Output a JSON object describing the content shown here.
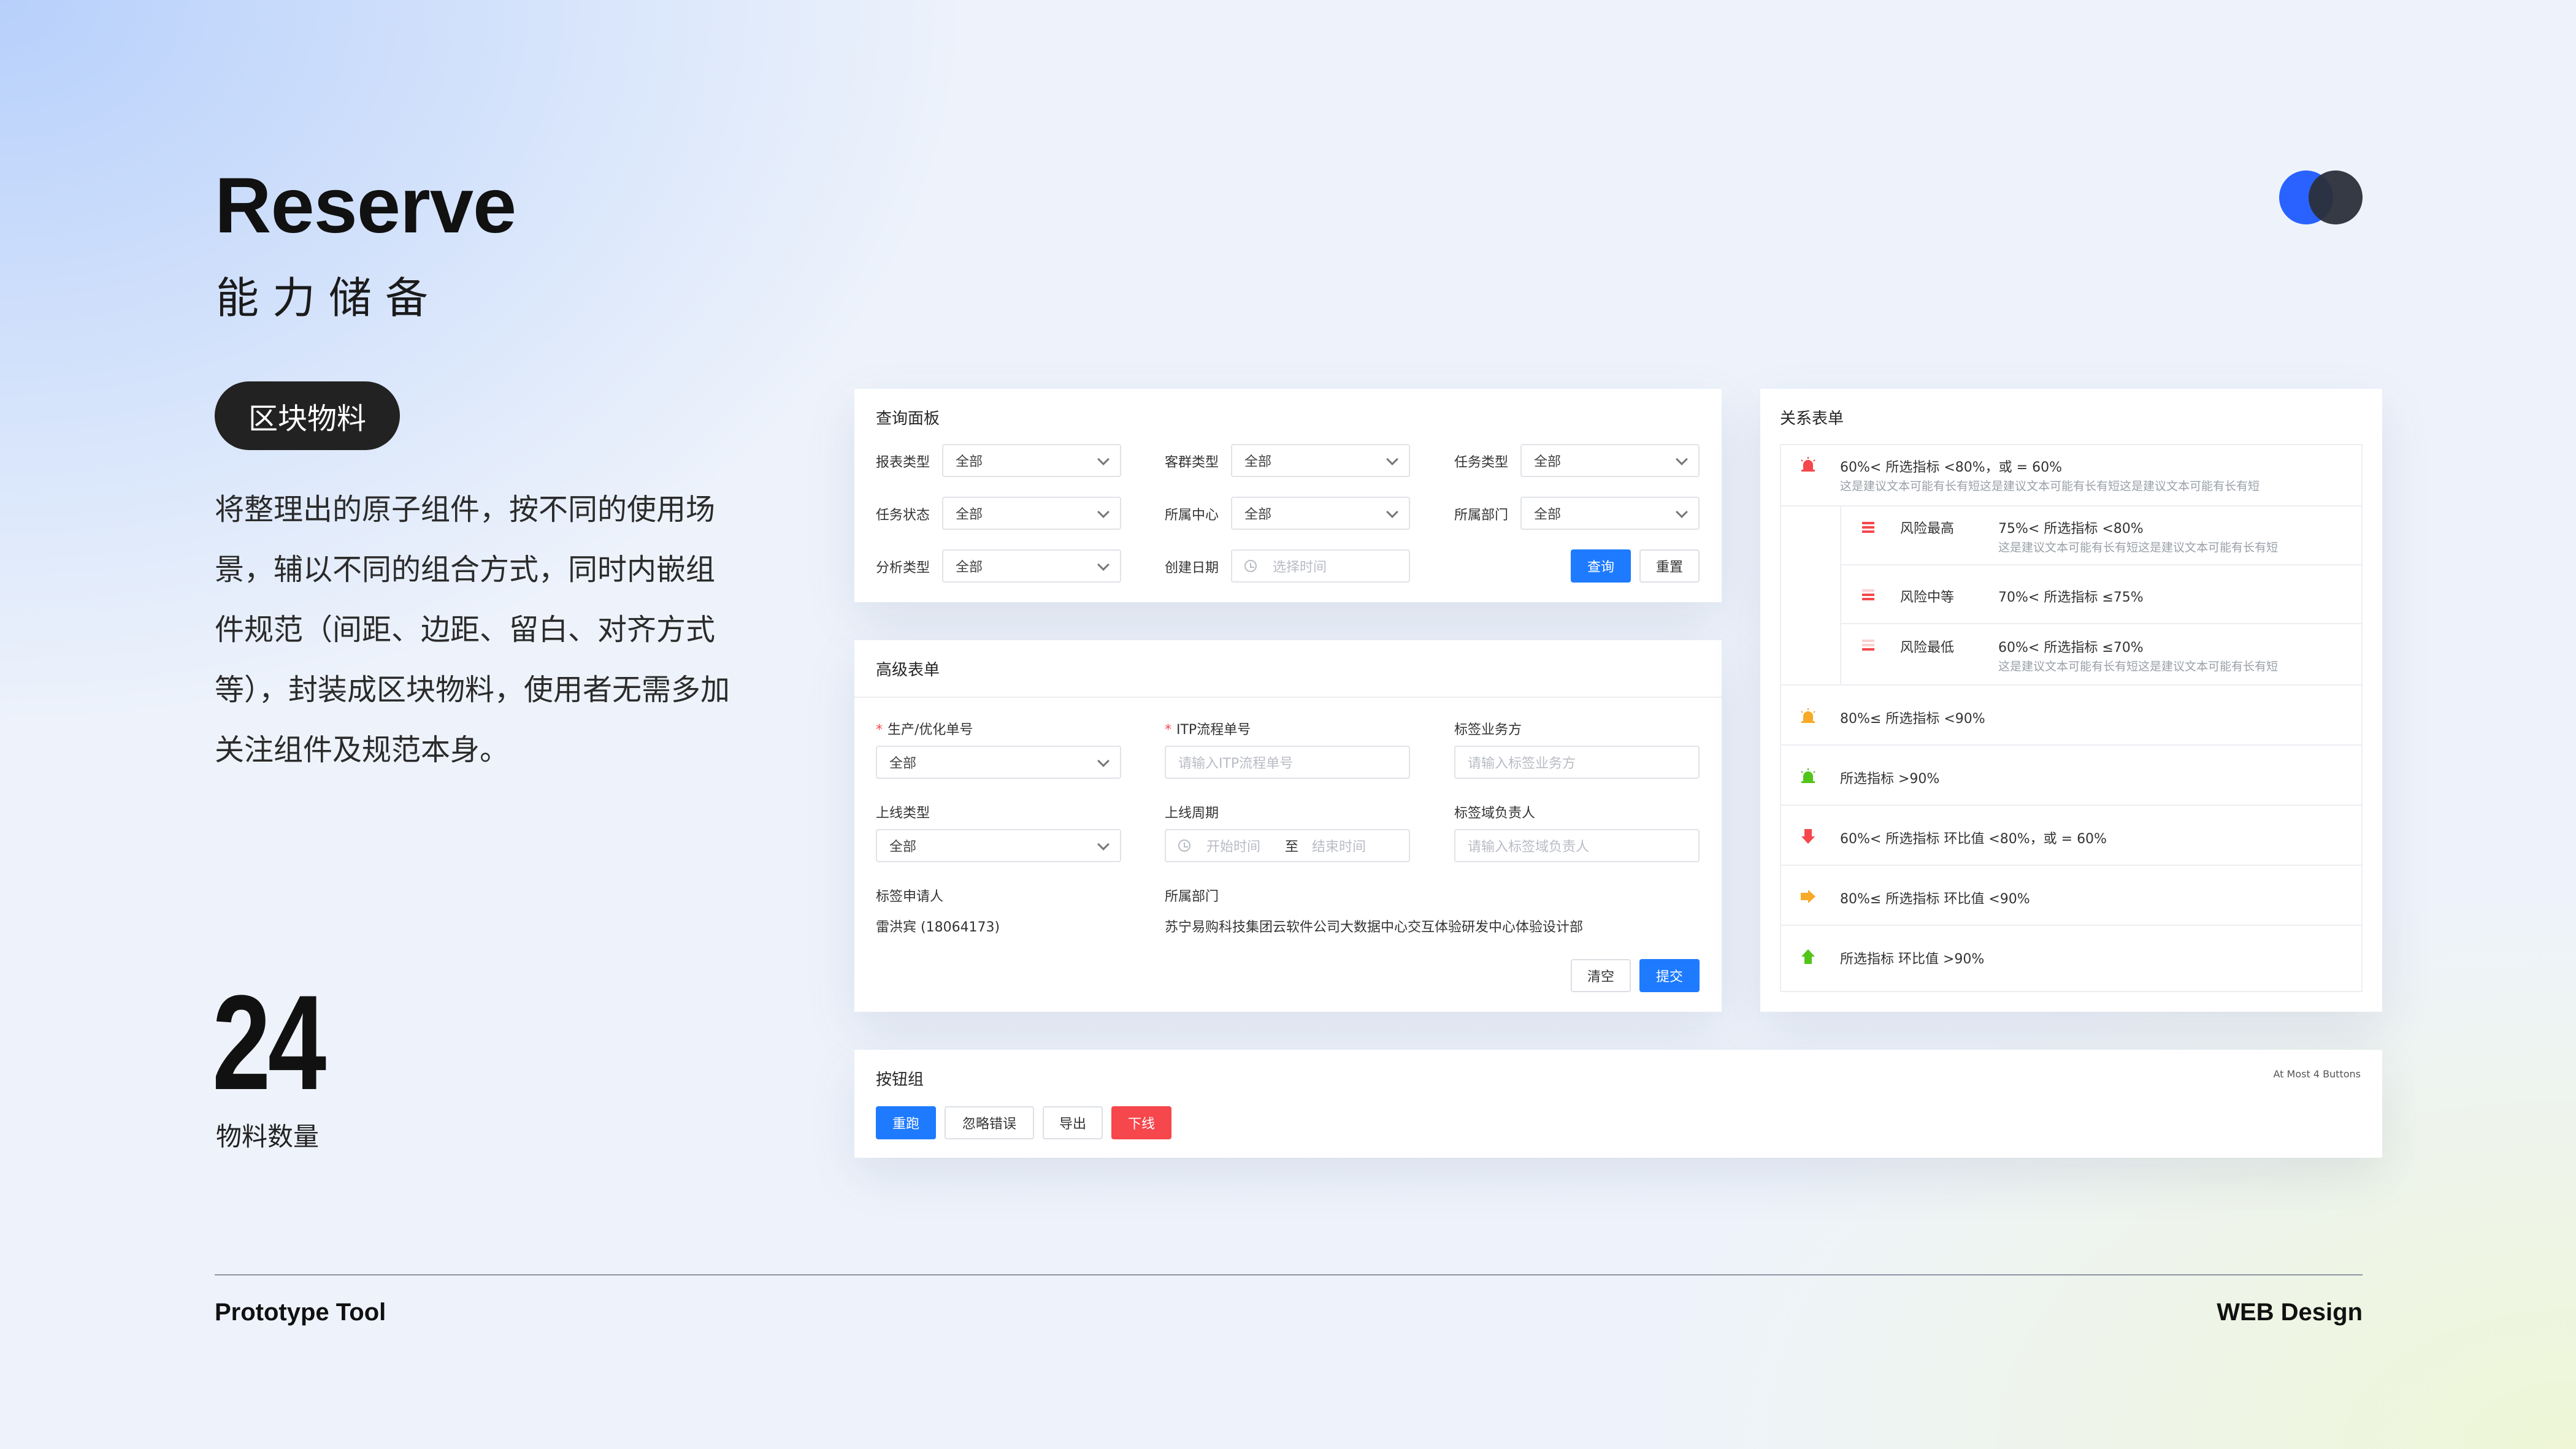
{
  "header": {
    "title": "Reserve",
    "subtitle": "能力储备"
  },
  "pill": "区块物料",
  "description": "将整理出的原子组件，按不同的使用场景，辅以不同的组合方式，同时内嵌组件规范（间距、边距、留白、对齐方式等），封装成区块物料，使用者无需多加关注组件及规范本身。",
  "stats": {
    "count": "24",
    "label": "物料数量"
  },
  "footer": {
    "left": "Prototype Tool",
    "right": "WEB Design"
  },
  "colors": {
    "primary": "#1e7bff",
    "danger": "#f5474c",
    "brand_blue": "#2962ff",
    "dark": "#222222"
  },
  "query_panel": {
    "title": "查询面板",
    "fields": [
      {
        "label": "报表类型",
        "value": "全部"
      },
      {
        "label": "客群类型",
        "value": "全部"
      },
      {
        "label": "任务类型",
        "value": "全部"
      },
      {
        "label": "任务状态",
        "value": "全部"
      },
      {
        "label": "所属中心",
        "value": "全部"
      },
      {
        "label": "所属部门",
        "value": "全部"
      },
      {
        "label": "分析类型",
        "value": "全部"
      },
      {
        "label": "创建日期",
        "placeholder": "选择时间"
      }
    ],
    "search_label": "查询",
    "reset_label": "重置"
  },
  "advanced_form": {
    "title": "高级表单",
    "f1": {
      "label": "生产/优化单号",
      "value": "全部"
    },
    "f2": {
      "label": "ITP流程单号",
      "placeholder": "请输入ITP流程单号"
    },
    "f3": {
      "label": "标签业务方",
      "placeholder": "请输入标签业务方"
    },
    "f4": {
      "label": "上线类型",
      "value": "全部"
    },
    "f5": {
      "label": "上线周期",
      "start": "开始时间",
      "sep": "至",
      "end": "结束时间"
    },
    "f6": {
      "label": "标签域负责人",
      "placeholder": "请输入标签域负责人"
    },
    "f7": {
      "label": "标签申请人",
      "value": "雷洪宾 (18064173)"
    },
    "f8": {
      "label": "所属部门",
      "value": "苏宁易购科技集团云软件公司大数据中心交互体验研发中心体验设计部"
    },
    "clear_label": "清空",
    "submit_label": "提交"
  },
  "relation_table": {
    "title": "关系表单",
    "row1": {
      "text": "60%< 所选指标 <80%，或 = 60%",
      "note": "这是建议文本可能有长有短这是建议文本可能有长有短这是建议文本可能有长有短"
    },
    "sub1": {
      "level": "风险最高",
      "text": "75%< 所选指标 <80%",
      "note": "这是建议文本可能有长有短这是建议文本可能有长有短"
    },
    "sub2": {
      "level": "风险中等",
      "text": "70%< 所选指标 ≤75%"
    },
    "sub3": {
      "level": "风险最低",
      "text": "60%< 所选指标 ≤70%",
      "note": "这是建议文本可能有长有短这是建议文本可能有长有短"
    },
    "row2": {
      "text": "80%≤ 所选指标 <90%"
    },
    "row3": {
      "text": "所选指标 >90%"
    },
    "row4": {
      "text": "60%< 所选指标 环比值 <80%，或 = 60%"
    },
    "row5": {
      "text": "80%≤ 所选指标 环比值 <90%"
    },
    "row6": {
      "text": "所选指标 环比值 >90%"
    }
  },
  "button_group": {
    "title": "按钮组",
    "note": "At Most 4 Buttons",
    "buttons": [
      "重跑",
      "忽略错误",
      "导出",
      "下线"
    ]
  }
}
